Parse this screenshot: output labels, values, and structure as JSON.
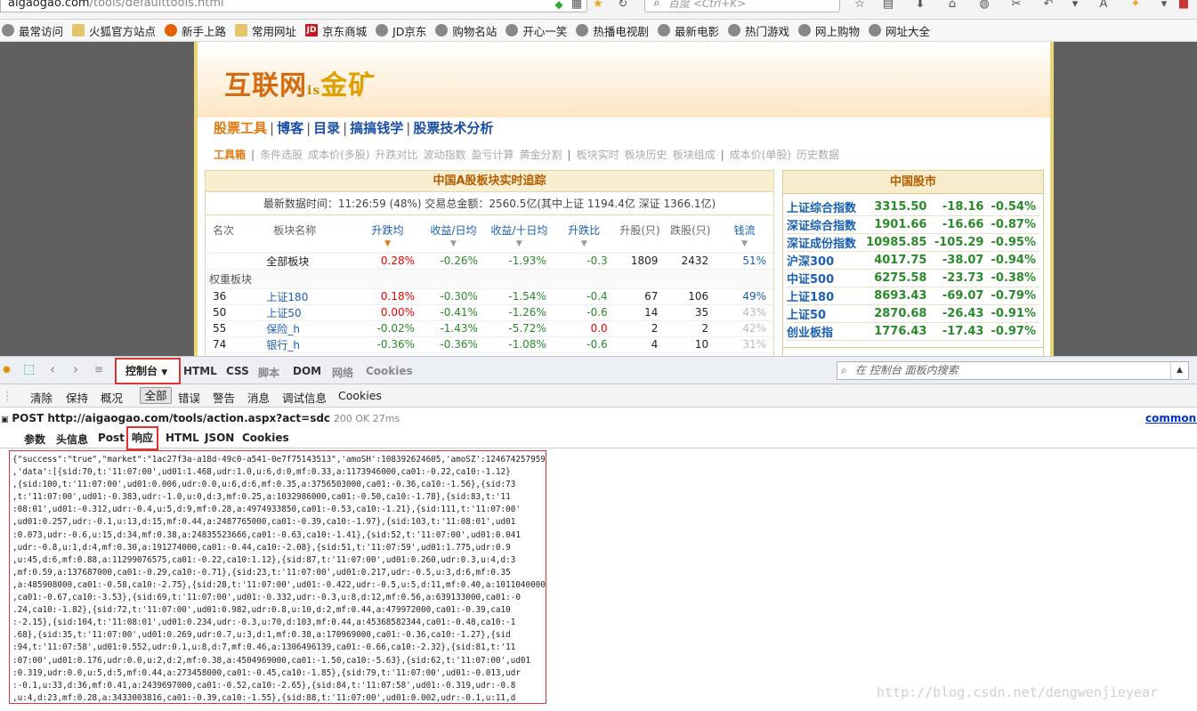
{
  "browser": {
    "url_domain": "aigaogao.com",
    "url_path": "/tools/defaulttools.html",
    "search_placeholder": "百度 <Ctrl+K>"
  },
  "bookmarks": [
    {
      "label": "最常访问",
      "icon": "gear-icon"
    },
    {
      "label": "火狐官方站点",
      "icon": "folder-icon"
    },
    {
      "label": "新手上路",
      "icon": "firefox-icon"
    },
    {
      "label": "常用网址",
      "icon": "folder-icon"
    },
    {
      "label": "京东商城",
      "icon": "jd-icon"
    },
    {
      "label": "JD京东",
      "icon": "globe-icon"
    },
    {
      "label": "购物名站",
      "icon": "globe-icon"
    },
    {
      "label": "开心一笑",
      "icon": "globe-icon"
    },
    {
      "label": "热播电视剧",
      "icon": "globe-icon"
    },
    {
      "label": "最新电影",
      "icon": "globe-icon"
    },
    {
      "label": "热门游戏",
      "icon": "globe-icon"
    },
    {
      "label": "网上购物",
      "icon": "globe-icon"
    },
    {
      "label": "网址大全",
      "icon": "globe-icon"
    }
  ],
  "site": {
    "logo_main": "互联网",
    "logo_is": "is",
    "logo_gold": "金矿",
    "nav": [
      "股票工具",
      "博客",
      "目录",
      "搞搞钱学",
      "股票技术分析"
    ],
    "subnav": {
      "current": "工具箱",
      "group1": [
        "条件选股",
        "成本价(多股)",
        "升跌对比",
        "波动指数",
        "盈亏计算",
        "黄金分割"
      ],
      "group2": [
        "板块实时",
        "板块历史",
        "板块组成"
      ],
      "group3": [
        "成本价(单股)",
        "历史数据"
      ]
    },
    "sector": {
      "title": "中国A股板块实时追踪",
      "info": "最新数据时间：11:26:59 (48%)      交易总金额：2560.5亿(其中上证 1194.4亿 深证 1366.1亿)",
      "headers": [
        "名次",
        "板块名称",
        "升跌均",
        "收益/日均",
        "收益/十日均",
        "升跌比",
        "升股(只)",
        "跌股(只)",
        "钱流"
      ],
      "all_row": {
        "name": "全部板块",
        "chg": "0.28%",
        "d1": "-0.26%",
        "d10": "-1.93%",
        "ratio": "-0.3",
        "up": "1809",
        "down": "2432",
        "flow": "51%"
      },
      "group_label": "权重板块",
      "rows": [
        {
          "rank": "36",
          "name": "上证180",
          "chg": "0.18%",
          "d1": "-0.30%",
          "d10": "-1.54%",
          "ratio": "-0.4",
          "up": "67",
          "down": "106",
          "flow": "49%"
        },
        {
          "rank": "50",
          "name": "上证50",
          "chg": "0.00%",
          "d1": "-0.41%",
          "d10": "-1.26%",
          "ratio": "-0.6",
          "up": "14",
          "down": "35",
          "flow": "43%"
        },
        {
          "rank": "55",
          "name": "保险_h",
          "chg": "-0.02%",
          "d1": "-1.43%",
          "d10": "-5.72%",
          "ratio": "0.0",
          "up": "2",
          "down": "2",
          "flow": "42%"
        },
        {
          "rank": "74",
          "name": "银行_h",
          "chg": "-0.36%",
          "d1": "-0.36%",
          "d10": "-1.08%",
          "ratio": "-0.6",
          "up": "4",
          "down": "10",
          "flow": "31%"
        }
      ]
    },
    "market": {
      "title": "中国股市",
      "rows": [
        {
          "name": "上证综合指数",
          "price": "3315.50",
          "chg": "-18.16",
          "pct": "-0.54%"
        },
        {
          "name": "深证综合指数",
          "price": "1901.66",
          "chg": "-16.66",
          "pct": "-0.87%"
        },
        {
          "name": "深证成份指数",
          "price": "10985.85",
          "chg": "-105.29",
          "pct": "-0.95%"
        },
        {
          "name": "沪深300",
          "price": "4017.75",
          "chg": "-38.07",
          "pct": "-0.94%"
        },
        {
          "name": "中证500",
          "price": "6275.58",
          "chg": "-23.73",
          "pct": "-0.38%"
        },
        {
          "name": "上证180",
          "price": "8693.43",
          "chg": "-69.07",
          "pct": "-0.79%"
        },
        {
          "name": "上证50",
          "price": "2870.68",
          "chg": "-26.43",
          "pct": "-0.91%"
        },
        {
          "name": "创业板指",
          "price": "1776.43",
          "chg": "-17.43",
          "pct": "-0.97%"
        }
      ]
    }
  },
  "devtools": {
    "console_tab": "控制台",
    "tabs": [
      "HTML",
      "CSS",
      "脚本",
      "DOM",
      "网络",
      "Cookies"
    ],
    "search_placeholder": "在 控制台 面板内搜索",
    "console_buttons": [
      "清除",
      "保持",
      "概况"
    ],
    "filters": [
      "全部",
      "错误",
      "警告",
      "消息",
      "调试信息",
      "Cookies"
    ],
    "request": {
      "method_url": "POST http://aigaogao.com/tools/action.aspx?act=sdc",
      "status": "200 OK 27ms",
      "file": "common.js"
    },
    "response_tabs": [
      "参数",
      "头信息",
      "Post",
      "响应",
      "HTML",
      "JSON",
      "Cookies"
    ],
    "response_lines": [
      "{\"success\":\"true\",\"market\":\"1ac27f3a-a18d-49c0-a541-0e7f75143513\",'amoSH':108392624605,'amoSZ':124674257959",
      ",'data':[{sid:70,t:'11:07:00',ud01:1.468,udr:1.0,u:6,d:0,mf:0.33,a:1173946000,ca01:-0.22,ca10:-1.12}",
      ",{sid:100,t:'11:07:00',ud01:0.006,udr:0.0,u:6,d:6,mf:0.35,a:3756503000,ca01:-0.36,ca10:-1.56},{sid:73",
      ",t:'11:07:00',ud01:-0.383,udr:-1.0,u:0,d:3,mf:0.25,a:1032986000,ca01:-0.50,ca10:-1.78},{sid:83,t:'11",
      ":08:01',ud01:-0.312,udr:-0.4,u:5,d:9,mf:0.28,a:4974933850,ca01:-0.53,ca10:-1.21},{sid:111,t:'11:07:00'",
      ",ud01:0.257,udr:-0.1,u:13,d:15,mf:0.44,a:2487765000,ca01:-0.39,ca10:-1.97},{sid:103,t:'11:08:01',ud01",
      ":0.073,udr:-0.6,u:15,d:34,mf:0.38,a:24835523666,ca01:-0.63,ca10:-1.41},{sid:52,t:'11:07:00',ud01:0.041",
      ",udr:-0.8,u:1,d:4,mf:0.30,a:191274000,ca01:-0.44,ca10:-2.08},{sid:51,t:'11:07:59',ud01:1.775,udr:0.9",
      ",u:45,d:6,mf:0.88,a:11299076575,ca01:-0.22,ca10:1.12},{sid:87,t:'11:07:00',ud01:0.260,udr:0.3,u:4,d:3",
      ",mf:0.59,a:137687000,ca01:-0.29,ca10:-0.71},{sid:23,t:'11:07:00',ud01:0.217,udr:-0.5,u:3,d:6,mf:0.35",
      ",a:485908000,ca01:-0.58,ca10:-2.75},{sid:28,t:'11:07:00',ud01:-0.422,udr:-0.5,u:5,d:11,mf:0.40,a:1011040000",
      ",ca01:-0.67,ca10:-3.53},{sid:69,t:'11:07:00',ud01:-0.332,udr:-0.3,u:8,d:12,mf:0.56,a:639133000,ca01:-0",
      ".24,ca10:-1.82},{sid:72,t:'11:07:00',ud01:0.982,udr:0.8,u:10,d:2,mf:0.44,a:479972000,ca01:-0.39,ca10",
      ":-2.15},{sid:104,t:'11:08:01',ud01:0.234,udr:-0.3,u:70,d:103,mf:0.44,a:45368582344,ca01:-0.48,ca10:-1",
      ".68},{sid:35,t:'11:07:00',ud01:0.269,udr:0.7,u:3,d:1,mf:0.38,a:170969000,ca01:-0.36,ca10:-1.27},{sid",
      ":94,t:'11:07:58',ud01:0.552,udr:0.1,u:8,d:7,mf:0.46,a:1306496139,ca01:-0.66,ca10:-2.32},{sid:81,t:'11",
      ":07:00',ud01:0.176,udr:0.0,u:2,d:2,mf:0.38,a:4504969000,ca01:-1.50,ca10:-5.63},{sid:62,t:'11:07:00',ud01",
      ":0.319,udr:0.0,u:5,d:5,mf:0.44,a:273458000,ca01:-0.45,ca10:-1.85},{sid:79,t:'11:07:00',ud01:-0.013,udr",
      ":-0.1,u:33,d:36,mf:0.41,a:2439697000,ca01:-0.52,ca10:-2.65},{sid:84,t:'11:07:58',ud01:-0.319,udr:-0.8",
      ",u:4,d:23,mf:0.28,a:3433003816,ca01:-0.39,ca10:-1.55},{sid:88,t:'11:07:00',ud01:0.002,udr:-0.1,u:11,d"
    ],
    "watermark": "http://blog.csdn.net/dengwenjieyear"
  }
}
